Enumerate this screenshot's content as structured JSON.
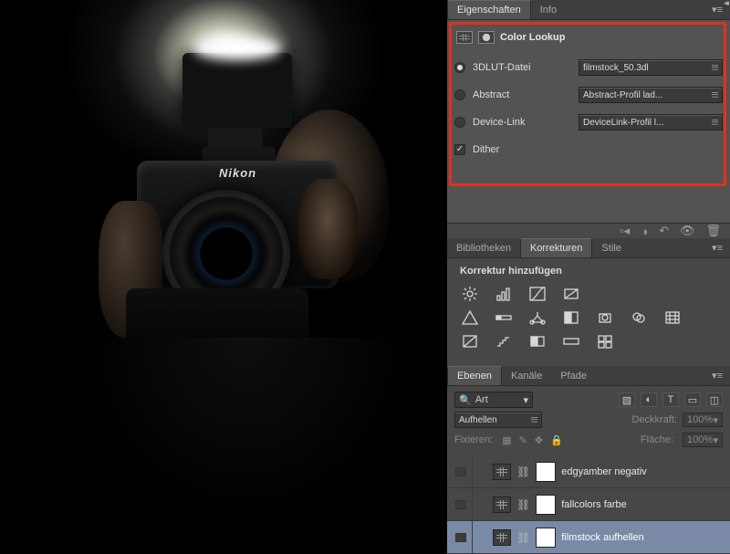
{
  "photo": {
    "brand": "Nikon"
  },
  "properties_panel": {
    "tabs": {
      "eigenschaften": "Eigenschaften",
      "info": "Info"
    },
    "title": "Color Lookup",
    "options": {
      "lut": {
        "label": "3DLUT-Datei",
        "value": "filmstock_50.3dl",
        "selected": true
      },
      "abstract": {
        "label": "Abstract",
        "value": "Abstract-Profil lad...",
        "selected": false
      },
      "devicelink": {
        "label": "Device-Link",
        "value": "DeviceLink-Profil l...",
        "selected": false
      },
      "dither": {
        "label": "Dither",
        "checked": true
      }
    }
  },
  "corrections_panel": {
    "tabs": {
      "bibliotheken": "Bibliotheken",
      "korrekturen": "Korrekturen",
      "stile": "Stile"
    },
    "add_label": "Korrektur hinzufügen"
  },
  "layers_panel": {
    "tabs": {
      "ebenen": "Ebenen",
      "kanaele": "Kanäle",
      "pfade": "Pfade"
    },
    "search_mode": "Art",
    "blend_mode": "Aufhellen",
    "opacity_label": "Deckkraft:",
    "opacity_value": "100%",
    "lock_label": "Fixieren:",
    "fill_label": "Fläche:",
    "fill_value": "100%",
    "layers": [
      {
        "name": "edgyamber negativ",
        "selected": false
      },
      {
        "name": "fallcolors farbe",
        "selected": false
      },
      {
        "name": "filmstock aufhellen",
        "selected": true
      }
    ]
  }
}
